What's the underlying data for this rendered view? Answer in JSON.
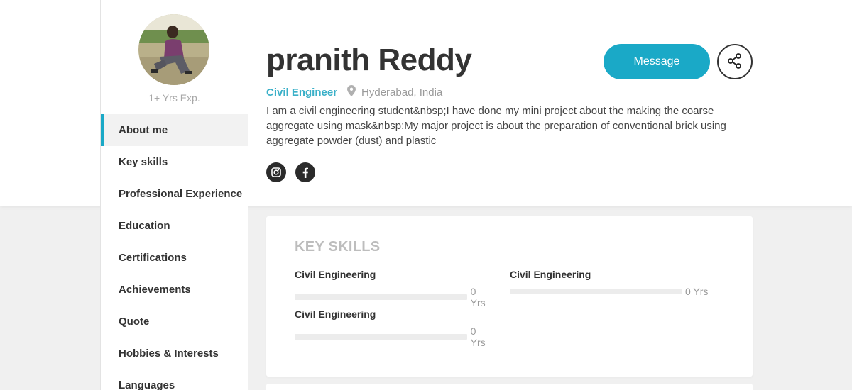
{
  "profile": {
    "name": "pranith Reddy",
    "role": "Civil Engineer",
    "location": "Hyderabad, India",
    "experience": "1+ Yrs Exp.",
    "bio": "I am a civil engineering student&nbsp;I have done my mini project about the making the coarse aggregate using mask&nbsp;My major project is about the preparation of conventional brick using aggregate powder (dust) and plastic"
  },
  "actions": {
    "message_label": "Message",
    "share_icon": "share-icon"
  },
  "socials": [
    {
      "icon": "instagram-icon"
    },
    {
      "icon": "facebook-icon"
    }
  ],
  "sidebar": {
    "items": [
      {
        "label": "About me",
        "active": true
      },
      {
        "label": "Key skills"
      },
      {
        "label": "Professional Experience"
      },
      {
        "label": "Education"
      },
      {
        "label": "Certifications"
      },
      {
        "label": "Achievements"
      },
      {
        "label": "Quote"
      },
      {
        "label": "Hobbies & Interests"
      },
      {
        "label": "Languages"
      }
    ]
  },
  "key_skills": {
    "title": "KEY SKILLS",
    "skills": [
      {
        "name": "Civil Engineering",
        "years": "0 Yrs",
        "level": 0
      },
      {
        "name": "Civil Engineering",
        "years": "0 Yrs",
        "level": 0
      },
      {
        "name": "Civil Engineering",
        "years": "0 Yrs",
        "level": 0
      }
    ]
  },
  "colors": {
    "accent": "#1aa9c7",
    "role_text": "#3ab0c8",
    "background": "#f0f0f0"
  }
}
